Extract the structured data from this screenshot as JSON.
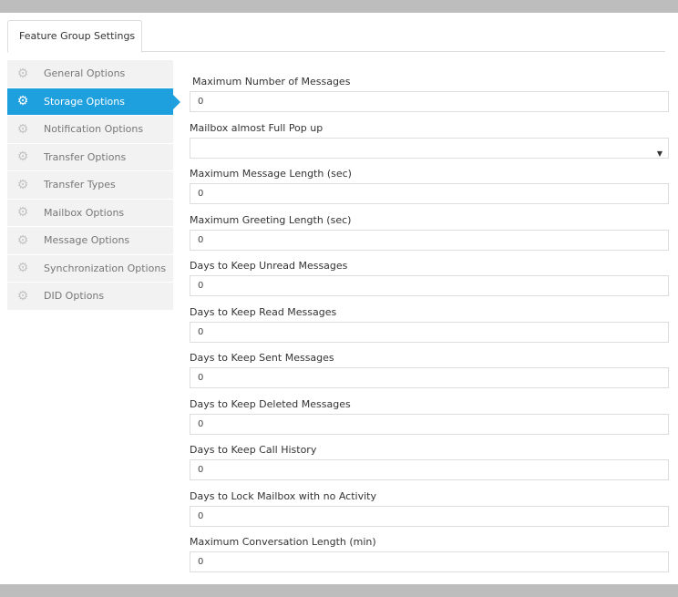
{
  "tab": {
    "label": "Feature Group Settings"
  },
  "sidebar": {
    "items": [
      {
        "label": "General Options",
        "icon": "gear-icon"
      },
      {
        "label": "Storage Options",
        "icon": "gear-icon",
        "active": true
      },
      {
        "label": "Notification Options",
        "icon": "gear-icon"
      },
      {
        "label": "Transfer Options",
        "icon": "gear-icon"
      },
      {
        "label": "Transfer Types",
        "icon": "gear-icon"
      },
      {
        "label": "Mailbox Options",
        "icon": "gear-icon"
      },
      {
        "label": "Message Options",
        "icon": "gear-icon"
      },
      {
        "label": "Synchronization Options",
        "icon": "gear-icon"
      },
      {
        "label": "DID Options",
        "icon": "gear-icon"
      }
    ]
  },
  "form": {
    "fields": [
      {
        "label": "Maximum Number of Messages",
        "value": "0"
      },
      {
        "label": "Mailbox almost Full Pop up",
        "value": "",
        "type": "select"
      },
      {
        "label": "Maximum Message Length (sec)",
        "value": "0"
      },
      {
        "label": "Maximum Greeting Length (sec)",
        "value": "0"
      },
      {
        "label": "Days to Keep Unread Messages",
        "value": "0"
      },
      {
        "label": "Days to Keep Read Messages",
        "value": "0"
      },
      {
        "label": "Days to Keep Sent Messages",
        "value": "0"
      },
      {
        "label": "Days to Keep Deleted Messages",
        "value": "0"
      },
      {
        "label": "Days to Keep Call History",
        "value": "0"
      },
      {
        "label": "Days to Lock Mailbox with no Activity",
        "value": "0"
      },
      {
        "label": "Maximum Conversation Length (min)",
        "value": "0"
      }
    ]
  },
  "colors": {
    "accent": "#1e9fde",
    "sidebar_bg": "#f2f2f2",
    "frame_bg": "#bdbdbd"
  }
}
